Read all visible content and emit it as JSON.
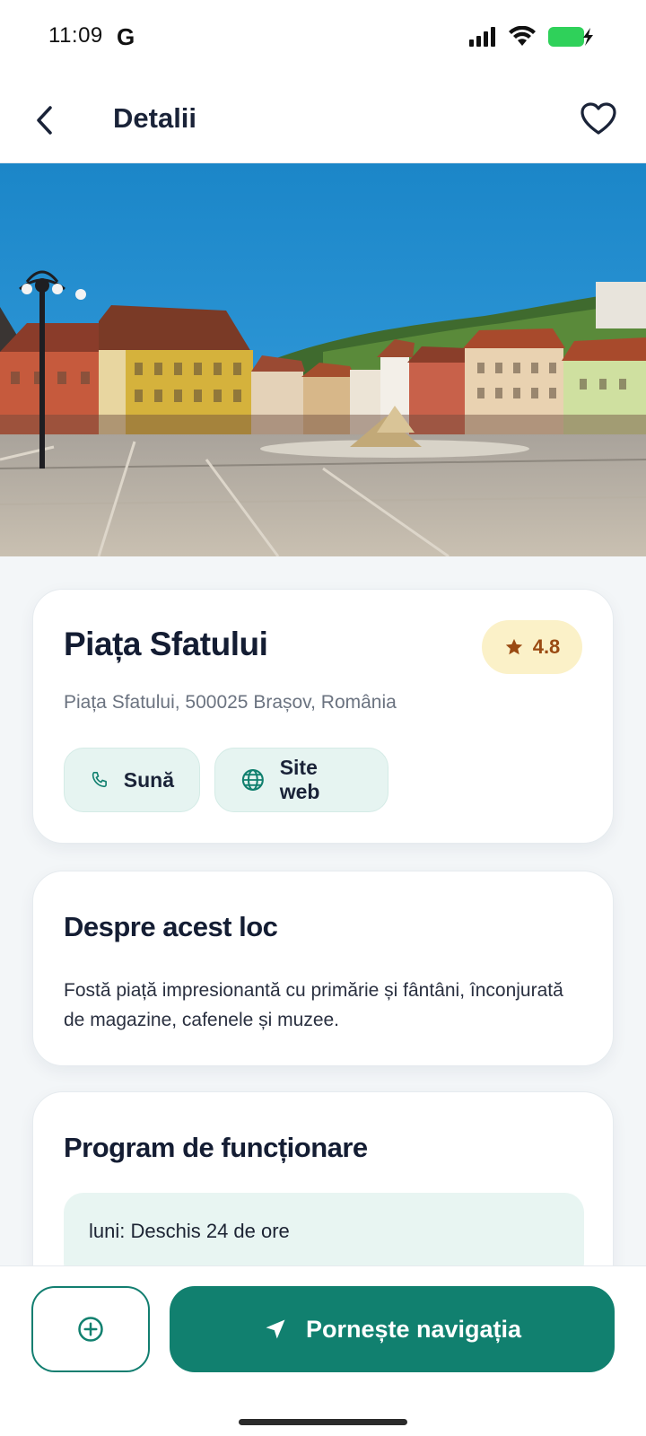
{
  "status_bar": {
    "time": "11:09",
    "g_label": "G",
    "icons": [
      "signal-icon",
      "wifi-icon",
      "battery-charging-icon"
    ]
  },
  "header": {
    "title": "Detalii",
    "back_icon": "chevron-left-icon",
    "favorite_icon": "heart-outline-icon"
  },
  "place": {
    "name": "Piața Sfatului",
    "rating": "4.8",
    "address": "Piața Sfatului, 500025 Brașov, România",
    "actions": {
      "call_label": "Sună",
      "web_label": "Site web"
    }
  },
  "about": {
    "title": "Despre acest loc",
    "text": "Fostă piață impresionantă cu primărie și fântâni, înconjurată de magazine, cafenele și muzee."
  },
  "hours": {
    "title": "Program de funcționare",
    "rows": [
      {
        "text": "luni: Deschis 24 de ore"
      }
    ]
  },
  "bottom": {
    "add_icon": "plus-circle-icon",
    "navigate_label": "Pornește navigația",
    "navigate_icon": "navigation-arrow-icon"
  },
  "colors": {
    "accent": "#11806f",
    "rating_bg": "#fbf1c8",
    "rating_text": "#9a4a12",
    "action_bg": "#e6f4f1"
  }
}
